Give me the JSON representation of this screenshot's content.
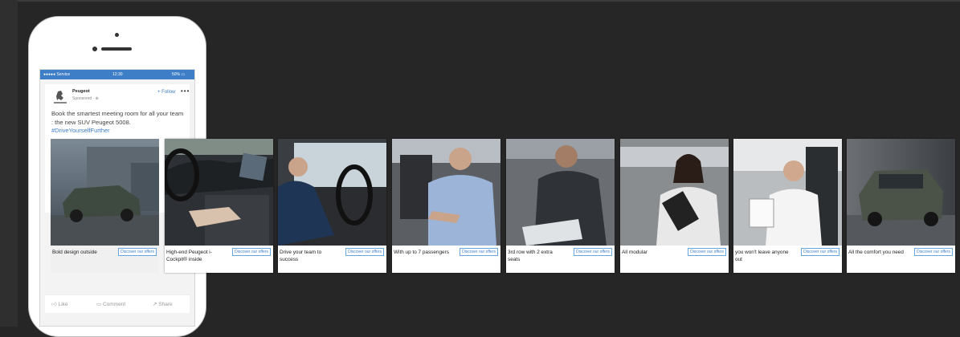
{
  "phone": {
    "status_left": "●●●●● Service",
    "status_time": "12:30",
    "status_right": "50% ▭",
    "brand_name": "Peugeot",
    "sponsored": "Sponsored · ⊕",
    "follow": "+ Follow",
    "more": "•••",
    "post_text": "Book the smartest meeting room for all your team : the new SUV Peugeot 5008.",
    "hashtag": "#DriveYourselfFurther",
    "actions": {
      "like": "Like",
      "comment": "Comment",
      "share": "Share"
    }
  },
  "carousel": {
    "button_label": "Discover our offers",
    "cards": [
      {
        "caption": "Bold design outside",
        "image": "suv-exterior-parked"
      },
      {
        "caption": "High-end Peugeot i-Cockpit® inside",
        "image": "cockpit-interior"
      },
      {
        "caption": "Drive your team to success",
        "image": "man-driving"
      },
      {
        "caption": "With up to 7 passengers",
        "image": "man-passenger-talking"
      },
      {
        "caption": "3rd row with 2 extra seats",
        "image": "man-rear-seat-tablet"
      },
      {
        "caption": "All modular",
        "image": "woman-smiling-phone"
      },
      {
        "caption": "you won't leave anyone out",
        "image": "man-writing-notes"
      },
      {
        "caption": "All the comfort you need",
        "image": "suv-driving-city"
      }
    ]
  },
  "colors": {
    "accent": "#3d7ec6",
    "background": "#262626"
  }
}
